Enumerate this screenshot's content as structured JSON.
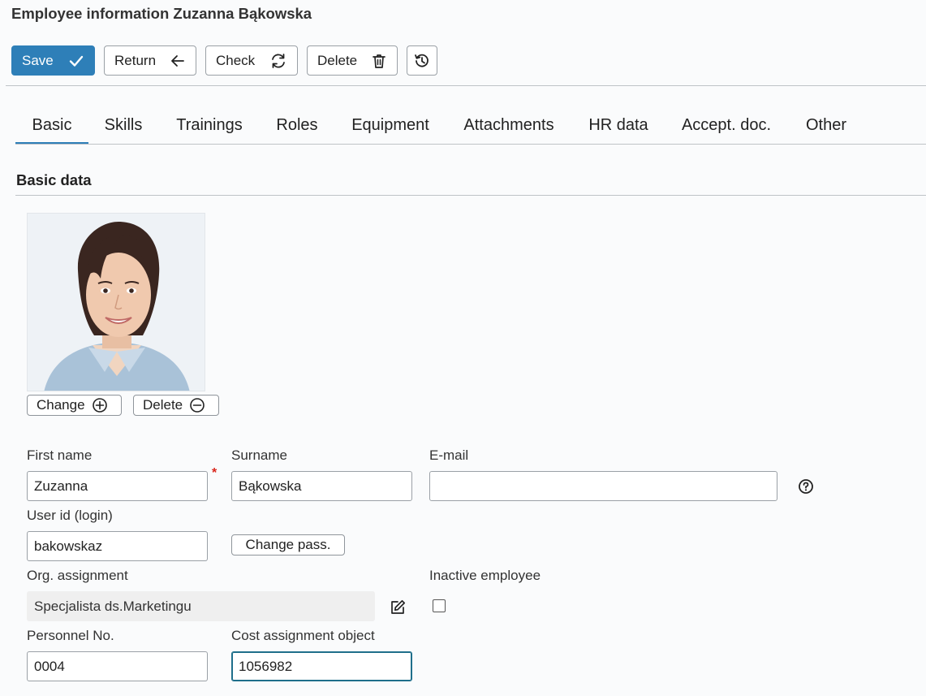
{
  "header": {
    "title": "Employee information Zuzanna Bąkowska"
  },
  "toolbar": {
    "save_label": "Save",
    "return_label": "Return",
    "check_label": "Check",
    "delete_label": "Delete",
    "icons": {
      "save": "check-icon",
      "return": "arrow-left-icon",
      "check": "refresh-icon",
      "delete": "trash-icon",
      "history": "history-icon"
    }
  },
  "tabs": [
    {
      "label": "Basic",
      "active": true
    },
    {
      "label": "Skills"
    },
    {
      "label": "Trainings"
    },
    {
      "label": "Roles"
    },
    {
      "label": "Equipment"
    },
    {
      "label": "Attachments"
    },
    {
      "label": "HR data"
    },
    {
      "label": "Accept. doc."
    },
    {
      "label": "Other"
    }
  ],
  "section": {
    "title": "Basic data"
  },
  "photo": {
    "change_label": "Change",
    "delete_label": "Delete",
    "icons": {
      "change": "plus-circle-icon",
      "delete": "minus-circle-icon"
    }
  },
  "form": {
    "first_name": {
      "label": "First name",
      "value": "Zuzanna",
      "required": true
    },
    "surname": {
      "label": "Surname",
      "value": "Bąkowska"
    },
    "email": {
      "label": "E-mail",
      "value": "",
      "help_icon": "question-circle-icon"
    },
    "user_id": {
      "label": "User id (login)",
      "value": "bakowskaz"
    },
    "change_pass_label": "Change pass.",
    "org_assignment": {
      "label": "Org. assignment",
      "value": "Specjalista ds.Marketingu",
      "edit_icon": "edit-icon"
    },
    "inactive_employee": {
      "label": "Inactive employee",
      "checked": false
    },
    "personnel_no": {
      "label": "Personnel No.",
      "value": "0004"
    },
    "cost_assignment": {
      "label": "Cost assignment object",
      "value": "1056982"
    }
  },
  "colors": {
    "primary": "#2e7fb8",
    "required": "#d9261c",
    "focus": "#1f6f8b",
    "background": "#fafbfc"
  }
}
